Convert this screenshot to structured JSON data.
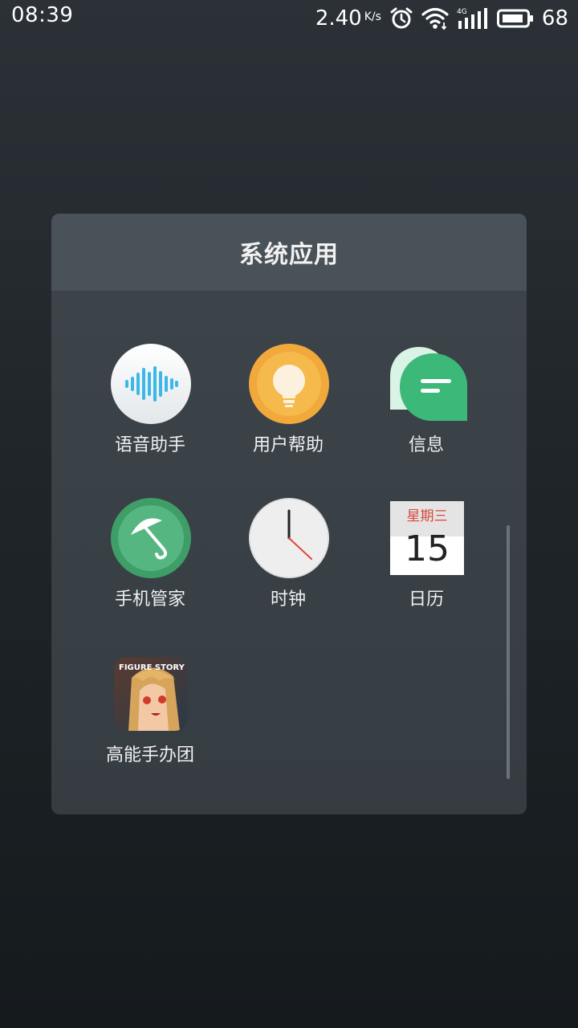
{
  "status_bar": {
    "time": "08:39",
    "net_speed": "2.40",
    "net_speed_unit": "K/s",
    "battery_level": "68",
    "icons": [
      "alarm-icon",
      "wifi-icon",
      "signal-4g-icon",
      "battery-icon"
    ]
  },
  "folder": {
    "title": "系统应用",
    "apps": [
      {
        "label": "语音助手",
        "icon": "voice-assistant-icon"
      },
      {
        "label": "用户帮助",
        "icon": "lightbulb-icon"
      },
      {
        "label": "信息",
        "icon": "message-icon"
      },
      {
        "label": "手机管家",
        "icon": "umbrella-icon"
      },
      {
        "label": "时钟",
        "icon": "clock-icon"
      },
      {
        "label": "日历",
        "icon": "calendar-icon"
      },
      {
        "label": "高能手办团",
        "icon": "game-figure-story-icon"
      }
    ],
    "calendar": {
      "weekday": "星期三",
      "day": "15"
    },
    "game_logo_text": "FIGURE STORY"
  },
  "colors": {
    "voice_wave": "#3cb8e8",
    "help_orange": "#f2a93b",
    "message_green": "#3cb878",
    "guard_green": "#4cae78",
    "calendar_red": "#d9473b"
  }
}
